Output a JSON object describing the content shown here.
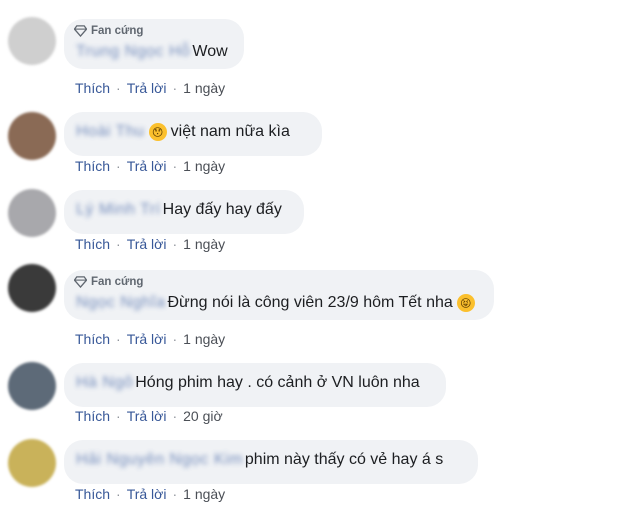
{
  "comments": [
    {
      "badge": "Fan cứng",
      "name": "Trung Ngọc Hỗ",
      "text": "Wow",
      "emoji": "",
      "like": "Thích",
      "reply": "Trả lời",
      "time": "1 ngày",
      "avatar": "#cfcfcf"
    },
    {
      "badge": "",
      "name": "Hoài Thu",
      "text": "việt nam nữa kìa",
      "emoji": "😯",
      "like": "Thích",
      "reply": "Trả lời",
      "time": "1 ngày",
      "avatar": "#8a6a55"
    },
    {
      "badge": "",
      "name": "Lý Minh Trí",
      "text": "Hay đấy hay đấy",
      "emoji": "",
      "like": "Thích",
      "reply": "Trả lời",
      "time": "1 ngày",
      "avatar": "#a8a8ac"
    },
    {
      "badge": "Fan cứng",
      "name": "Ngọc Nghĩa",
      "text": "Đừng nói là công viên 23/9 hôm Tết nha",
      "emoji": "😝",
      "like": "Thích",
      "reply": "Trả lời",
      "time": "1 ngày",
      "avatar": "#3a3a3a"
    },
    {
      "badge": "",
      "name": "Hà Ngô",
      "text": "Hóng phim hay . có cảnh ở VN luôn nha",
      "emoji": "",
      "like": "Thích",
      "reply": "Trả lời",
      "time": "20 giờ",
      "avatar": "#5d6a78"
    },
    {
      "badge": "",
      "name": "Hải Nguyên Ngọc Kim",
      "text": "phim này thấy có vẻ hay á s",
      "emoji": "",
      "like": "Thích",
      "reply": "Trả lời",
      "time": "1 ngày",
      "avatar": "#c9b25a"
    }
  ]
}
